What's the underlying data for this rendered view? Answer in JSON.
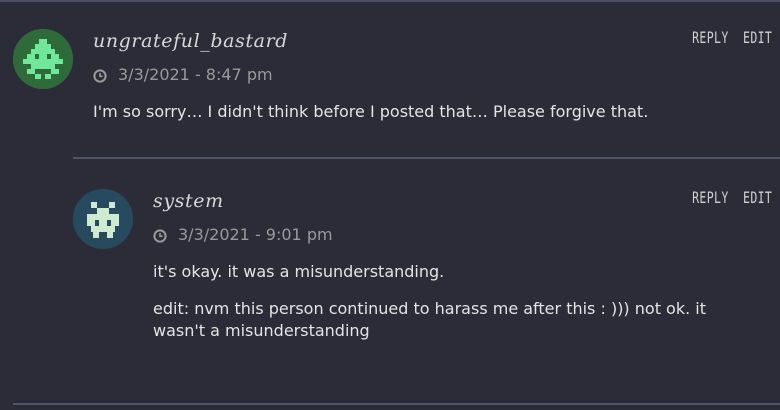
{
  "comments": [
    {
      "username": "ungrateful_bastard",
      "timestamp": "3/3/2021 - 8:47 pm",
      "reply_label": "REPLY",
      "edit_label": "EDIT",
      "body": "I'm so sorry… I didn't think before I posted that… Please forgive that.",
      "avatar_color": "#2f6b3a",
      "avatar_sprite_color": "#6fe89a"
    },
    {
      "username": "system",
      "timestamp": "3/3/2021 - 9:01 pm",
      "reply_label": "REPLY",
      "edit_label": "EDIT",
      "body": "it's okay. it was a misunderstanding.",
      "body_edit": "edit: nvm this person continued to harass me after this : ))) not ok. it wasn't a misunderstanding",
      "avatar_color": "#274a5e",
      "avatar_sprite_color": "#cdeccf"
    }
  ]
}
